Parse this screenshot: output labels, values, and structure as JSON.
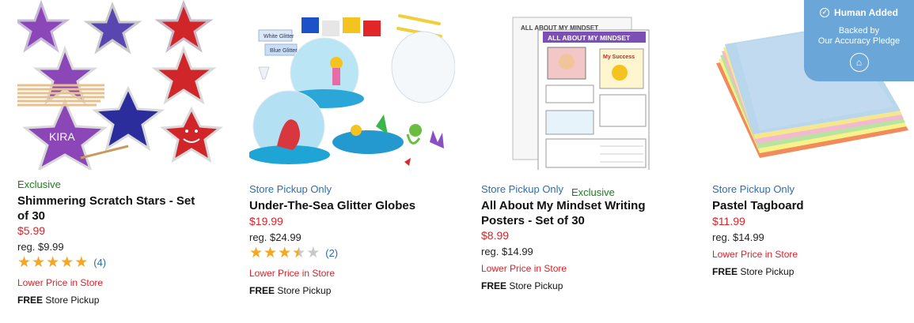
{
  "products": [
    {
      "badge": "Exclusive",
      "title": "Shimmering Scratch Stars - Set of 30",
      "price": "$5.99",
      "reg": "reg. $9.99",
      "rating_value": 5,
      "rating_count": "(4)",
      "lower": "Lower Price in Store",
      "free": "FREE",
      "pickup_label": "Store Pickup",
      "image_text": "KIRA"
    },
    {
      "availability": "Store Pickup Only",
      "title": "Under-The-Sea Glitter Globes",
      "price": "$19.99",
      "reg": "reg. $24.99",
      "rating_value": 3.5,
      "rating_count": "(2)",
      "lower": "Lower Price in Store",
      "free": "FREE",
      "pickup_label": "Store Pickup",
      "image_text": {
        "tag1": "White Glitter",
        "tag2": "Blue Glitter"
      }
    },
    {
      "availability": "Store Pickup Only",
      "badge": "Exclusive",
      "title": "All About My Mindset Writing Posters - Set of 30",
      "price": "$8.99",
      "reg": "reg. $14.99",
      "lower": "Lower Price in Store",
      "free": "FREE",
      "pickup_label": "Store Pickup",
      "image_text": {
        "heading": "ALL ABOUT MY MINDSET",
        "back_heading": "ALL ABOUT MY MINDSET",
        "success": "My Success"
      }
    },
    {
      "availability": "Store Pickup Only",
      "title": "Pastel Tagboard",
      "price": "$11.99",
      "reg": "reg. $14.99",
      "lower": "Lower Price in Store",
      "free": "FREE",
      "pickup_label": "Store Pickup"
    }
  ],
  "overlay": {
    "title": "Human Added",
    "line1": "Backed by",
    "line2": "Our Accuracy Pledge"
  },
  "colors": {
    "price": "#d8232a",
    "exclusive": "#1a7f1a",
    "link": "#2a6fb0",
    "star": "#f5a623"
  }
}
